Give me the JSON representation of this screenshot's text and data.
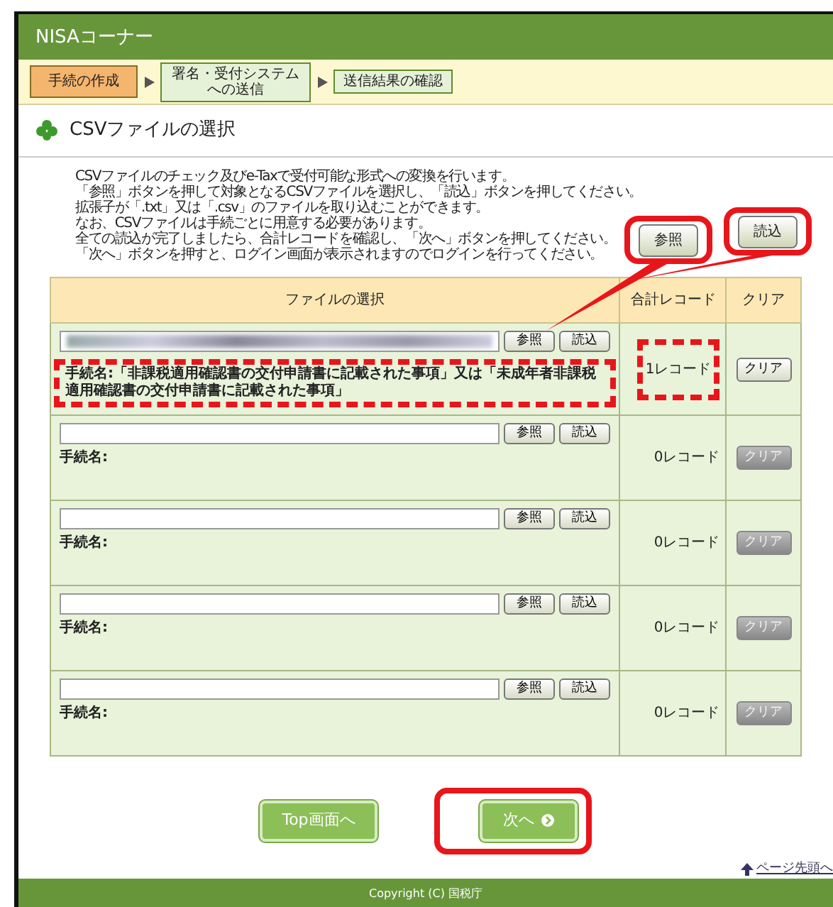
{
  "header": {
    "title": "NISAコーナー"
  },
  "steps": [
    {
      "label": "手続の作成",
      "selected": true
    },
    {
      "label": "署名・受付システムへの送信",
      "selected": false
    },
    {
      "label": "送信結果の確認",
      "selected": false
    }
  ],
  "section_title": "CSVファイルの選択",
  "instructions": [
    "CSVファイルのチェック及びe-Taxで受付可能な形式への変換を行います。",
    "「参照」ボタンを押して対象となるCSVファイルを選択し、「読込」ボタンを押してください。",
    "拡張子が「.txt」又は「.csv」のファイルを取り込むことができます。",
    "なお、CSVファイルは手続ごとに用意する必要があります。",
    "全ての読込が完了しましたら、合計レコードを確認し、「次へ」ボタンを押してください。",
    "「次へ」ボタンを押すと、ログイン画面が表示されますのでログインを行ってください。"
  ],
  "table": {
    "columns": [
      "ファイルの選択",
      "合計レコード",
      "クリア"
    ],
    "rows": [
      {
        "blurred": true,
        "browse": "参照",
        "load": "読込",
        "procedure": "手続名:「非課税適用確認書の交付申請書に記載された事項」又は「未成年者非課税適用確認書の交付申請書に記載された事項」",
        "records": "1レコード",
        "clear": "クリア",
        "clear_disabled": false
      },
      {
        "blurred": false,
        "browse": "参照",
        "load": "読込",
        "procedure": "手続名:",
        "records": "0レコード",
        "clear": "クリア",
        "clear_disabled": true
      },
      {
        "blurred": false,
        "browse": "参照",
        "load": "読込",
        "procedure": "手続名:",
        "records": "0レコード",
        "clear": "クリア",
        "clear_disabled": true
      },
      {
        "blurred": false,
        "browse": "参照",
        "load": "読込",
        "procedure": "手続名:",
        "records": "0レコード",
        "clear": "クリア",
        "clear_disabled": true
      },
      {
        "blurred": false,
        "browse": "参照",
        "load": "読込",
        "procedure": "手続名:",
        "records": "0レコード",
        "clear": "クリア",
        "clear_disabled": true
      }
    ]
  },
  "buttons": [
    {
      "label": "Top画面へ",
      "kind": "plain"
    },
    {
      "label": "次へ",
      "kind": "next"
    }
  ],
  "page_top_link": "ページ先頭へ",
  "footer": "Copyright (C) 国税庁",
  "annotations": [
    {
      "kind": "callout",
      "button": "参照"
    },
    {
      "kind": "callout",
      "button": "読込"
    },
    {
      "kind": "dashed"
    },
    {
      "kind": "dashed"
    },
    {
      "kind": "frame"
    }
  ]
}
